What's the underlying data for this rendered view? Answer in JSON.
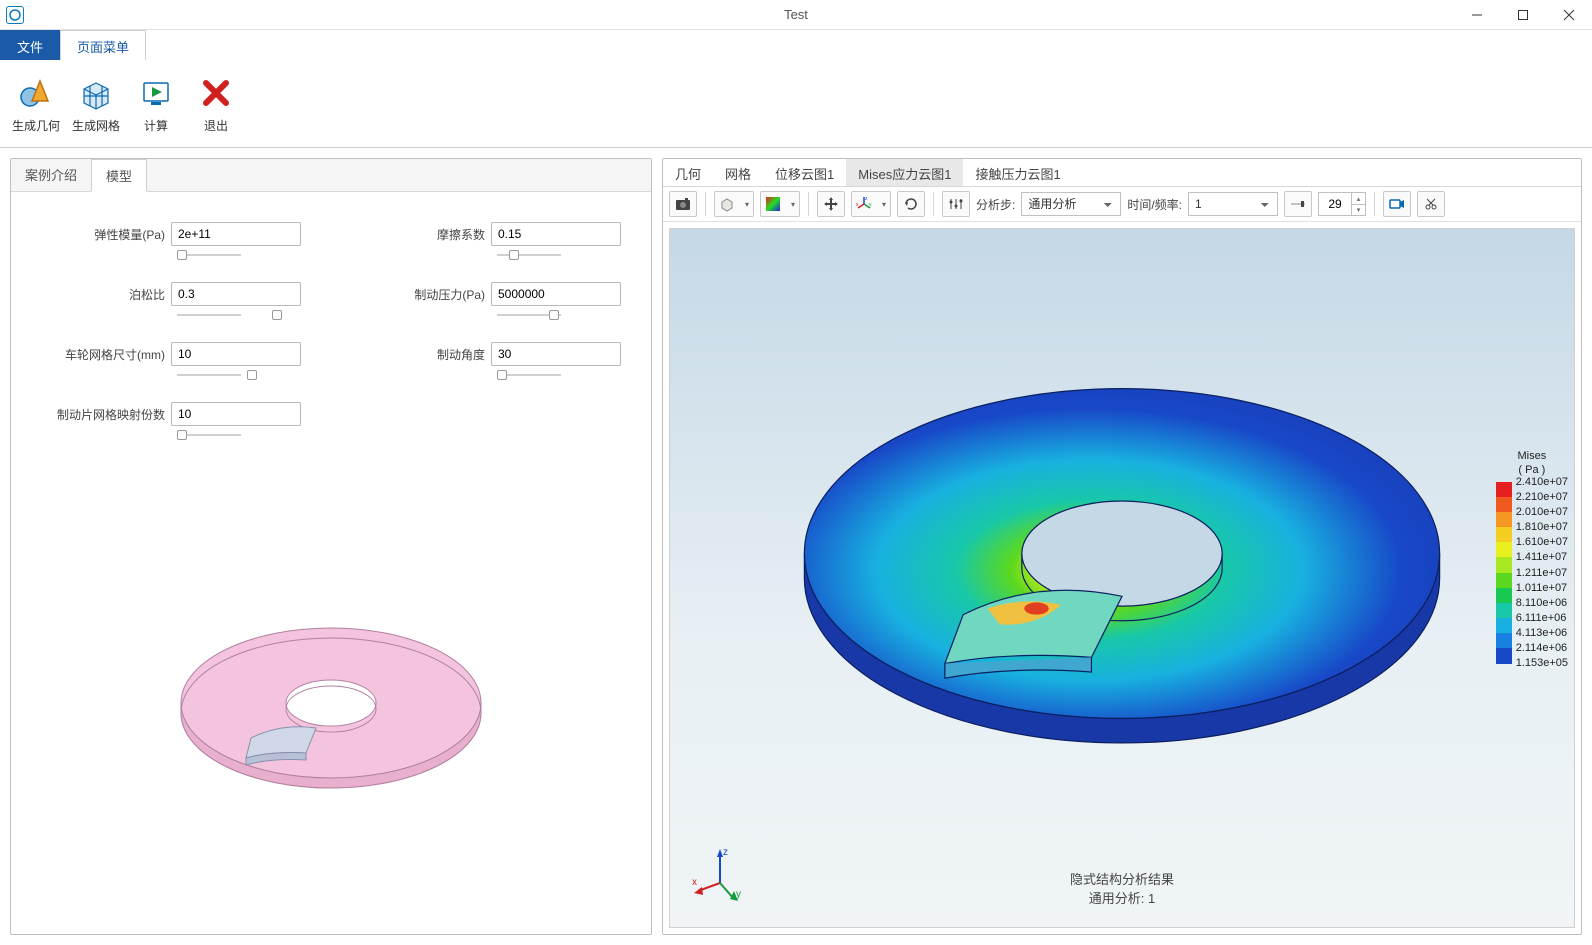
{
  "window": {
    "title": "Test"
  },
  "menu": {
    "file": "文件",
    "page_menu": "页面菜单"
  },
  "ribbon": {
    "gen_geometry": "生成几何",
    "gen_mesh": "生成网格",
    "compute": "计算",
    "exit": "退出"
  },
  "left_tabs": {
    "intro": "案例介绍",
    "model": "模型"
  },
  "form": {
    "elastic_modulus": {
      "label": "弹性模量(Pa)",
      "value": "2e+11"
    },
    "friction_coeff": {
      "label": "摩擦系数",
      "value": "0.15"
    },
    "poisson": {
      "label": "泊松比",
      "value": "0.3"
    },
    "brake_pressure": {
      "label": "制动压力(Pa)",
      "value": "5000000"
    },
    "wheel_mesh_size": {
      "label": "车轮网格尺寸(mm)",
      "value": "10"
    },
    "brake_angle": {
      "label": "制动角度",
      "value": "30"
    },
    "pad_mesh_map_count": {
      "label": "制动片网格映射份数",
      "value": "10"
    }
  },
  "right_tabs": {
    "geometry": "几何",
    "mesh": "网格",
    "displacement": "位移云图1",
    "mises": "Mises应力云图1",
    "contact_pressure": "接触压力云图1"
  },
  "toolbar": {
    "analysis_step_label": "分析步:",
    "analysis_step_value": "通用分析",
    "time_freq_label": "时间/频率:",
    "time_freq_value": "1",
    "frame_count": "29"
  },
  "result": {
    "caption_line1": "隐式结构分析结果",
    "caption_line2": "通用分析: 1"
  },
  "legend": {
    "title_line1": "Mises",
    "title_line2": "( Pa )",
    "values": [
      "2.410e+07",
      "2.210e+07",
      "2.010e+07",
      "1.810e+07",
      "1.610e+07",
      "1.411e+07",
      "1.211e+07",
      "1.011e+07",
      "8.110e+06",
      "6.111e+06",
      "4.113e+06",
      "2.114e+06",
      "1.153e+05"
    ],
    "colors": [
      "#e62020",
      "#f05a1e",
      "#f59720",
      "#f5cc20",
      "#e8f020",
      "#a8e820",
      "#5ad820",
      "#18c850",
      "#18c8a8",
      "#18b0e0",
      "#1880e0",
      "#1848c8"
    ]
  }
}
